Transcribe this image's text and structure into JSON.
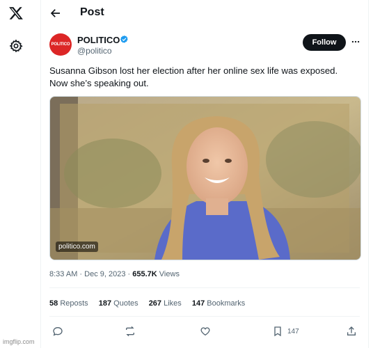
{
  "header": {
    "title": "Post"
  },
  "tweet": {
    "author_name": "POLITICO",
    "avatar_text": "POLITICO",
    "handle": "@politico",
    "follow_label": "Follow",
    "text_line1": "Susanna Gibson lost her election after her online sex life was exposed.",
    "text_line2": "Now she’s speaking out.",
    "media_source": "politico.com",
    "time": "8:33 AM",
    "date": "Dec 9, 2023",
    "views_count": "655.7K",
    "views_label": "Views",
    "stats": {
      "reposts_count": "58",
      "reposts_label": "Reposts",
      "quotes_count": "187",
      "quotes_label": "Quotes",
      "likes_count": "267",
      "likes_label": "Likes",
      "bookmarks_count": "147",
      "bookmarks_label": "Bookmarks"
    },
    "actions": {
      "bookmark_count": "147"
    }
  },
  "watermark": "imgflip.com",
  "colors": {
    "avatar": "#dc2626",
    "verified": "#1d9bf0",
    "follow_bg": "#0f1419",
    "muted": "#536471"
  }
}
